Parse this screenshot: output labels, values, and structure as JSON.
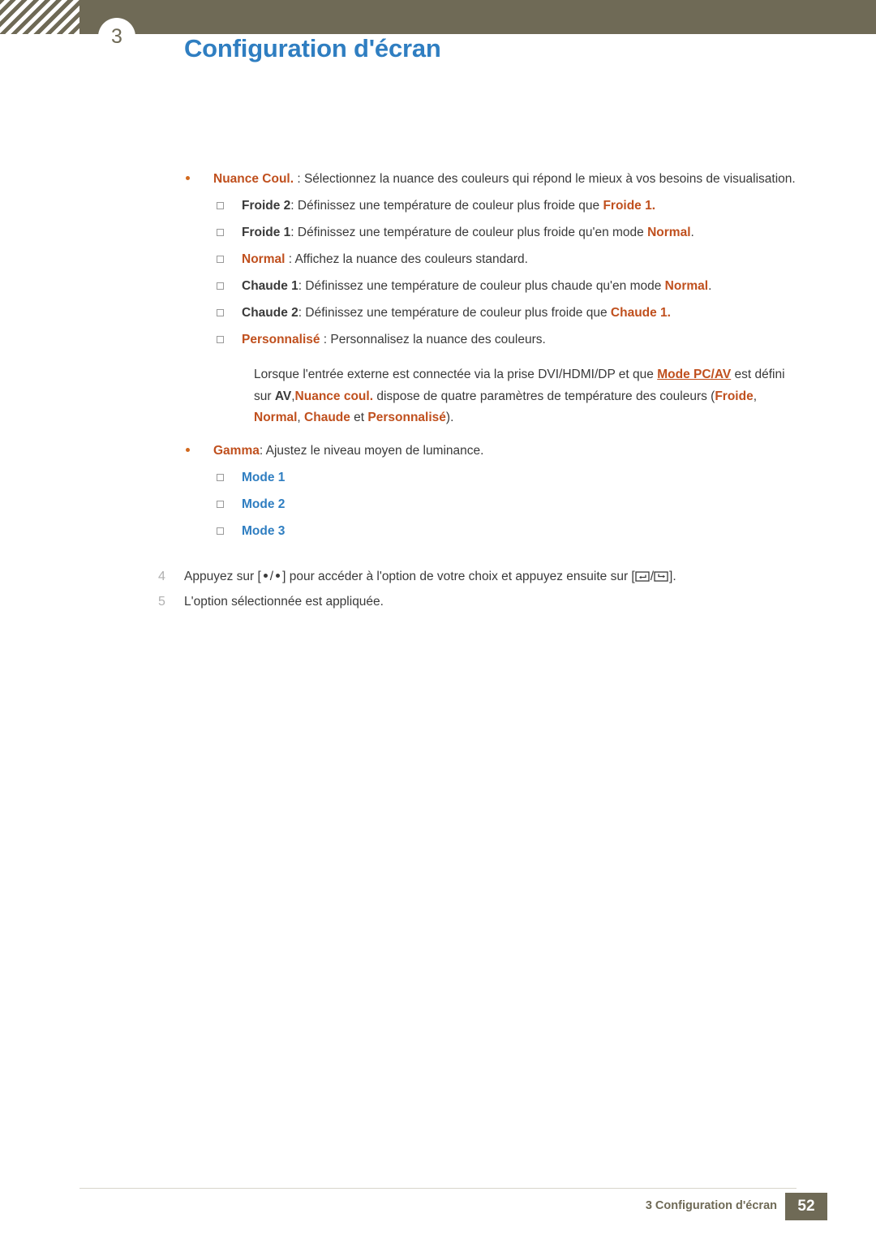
{
  "header": {
    "chapter_number": "3",
    "title": "Configuration d'écran"
  },
  "content": {
    "nuance_coul": {
      "term": "Nuance Coul.",
      "rest": " : Sélectionnez la nuance des couleurs qui répond le mieux à vos besoins de visualisation."
    },
    "sub_items": [
      {
        "term": "Froide 2",
        "mid": ": Définissez une température de couleur plus froide que ",
        "emph": "Froide",
        "tail": " 1."
      },
      {
        "term": "Froide 1",
        "mid": ": Définissez une température de couleur plus froide qu'en mode ",
        "emph": "Normal",
        "tail": "."
      },
      {
        "term": "Normal",
        "mid": " : Affichez la nuance des couleurs standard.",
        "emph": "",
        "tail": ""
      },
      {
        "term": "Chaude 1",
        "mid": ": Définissez une température de couleur plus chaude qu'en mode ",
        "emph": "Normal",
        "tail": "."
      },
      {
        "term": "Chaude 2",
        "mid": ": Définissez une température de couleur plus froide que ",
        "emph": "Chaude",
        "tail": " 1."
      },
      {
        "term": "Personnalisé",
        "mid": " : Personnalisez la nuance des couleurs.",
        "emph": "",
        "tail": ""
      }
    ],
    "note": {
      "part1": "Lorsque l'entrée externe est connectée via la prise DVI/HDMI/DP et que ",
      "link": "Mode PC/AV",
      "part2": " est défini sur ",
      "av": "AV",
      "part3": ",",
      "nuance": "Nuance coul.",
      "part4": " dispose de quatre paramètres de température des couleurs (",
      "opt1": "Froide",
      "sep1": ", ",
      "opt2": "Normal",
      "sep2": ", ",
      "opt3": "Chaude",
      "sep3": " et ",
      "opt4": "Personnalisé",
      "part5": ")."
    },
    "gamma": {
      "term": "Gamma",
      "rest": ": Ajustez le niveau moyen de luminance."
    },
    "gamma_modes": [
      "Mode 1",
      "Mode 2",
      "Mode 3"
    ],
    "steps": [
      {
        "num": "4",
        "pre": "Appuyez sur [",
        "sep": "/",
        "mid": "] pour accéder à l'option de votre choix et appuyez ensuite sur [",
        "keysep": "/",
        "post": "]."
      },
      {
        "num": "5",
        "text": "L'option sélectionnée est appliquée."
      }
    ]
  },
  "footer": {
    "text": "3 Configuration d'écran",
    "page": "52"
  },
  "colors": {
    "header_bar": "#6f6a56",
    "title_blue": "#2f7ec1",
    "accent_orange": "#c0501e",
    "body_text": "#3a3a3a"
  }
}
